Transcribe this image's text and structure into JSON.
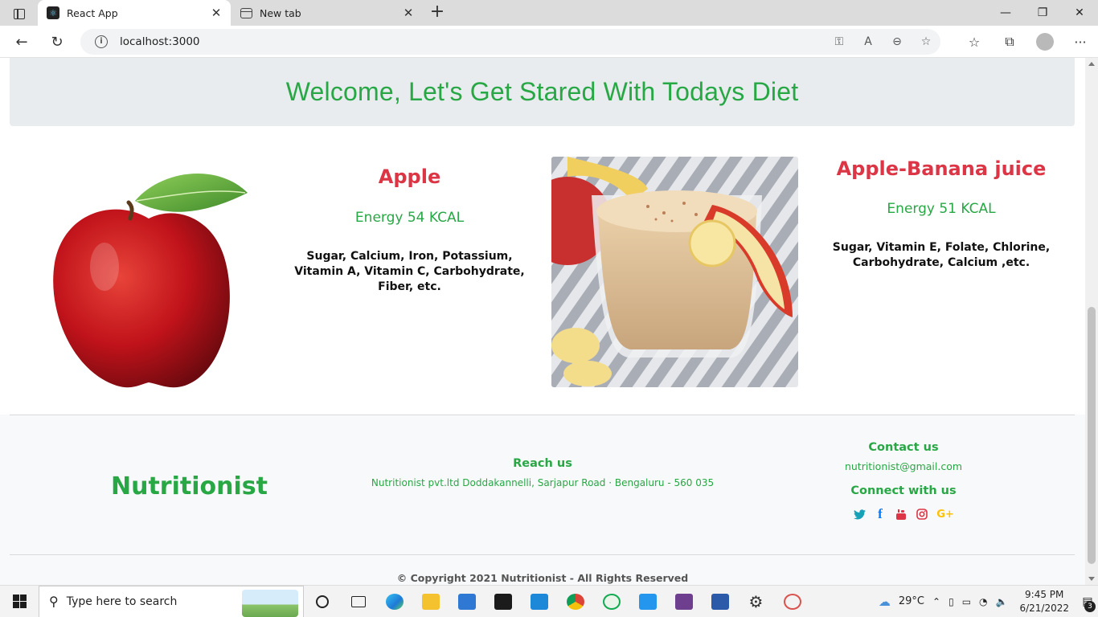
{
  "browser": {
    "tabs": [
      {
        "title": "React App",
        "active": true,
        "icon": "react-icon"
      },
      {
        "title": "New tab",
        "active": false,
        "icon": "new-tab-page-icon"
      }
    ],
    "new_tab_symbol": "+",
    "address_url": "localhost:3000",
    "window_controls": {
      "minimize": "—",
      "restore": "❐",
      "close": "✕"
    },
    "nav": {
      "back": "←",
      "refresh": "↻"
    },
    "address_icons": {
      "key": "⚿",
      "read_aloud": "A",
      "zoom": "⊖",
      "favorite": "☆"
    },
    "toolbar_icons": {
      "favorites": "☆",
      "collections": "⧉",
      "more": "···"
    }
  },
  "page": {
    "welcome_heading": "Welcome, Let's Get Stared With Todays Diet",
    "foods": [
      {
        "name": "Apple",
        "energy": "Energy 54 KCAL",
        "nutrients": "Sugar, Calcium, Iron, Potassium, Vitamin A, Vitamin C, Carbohydrate, Fiber, etc."
      },
      {
        "name": "Apple-Banana juice",
        "energy": "Energy 51 KCAL",
        "nutrients": "Sugar, Vitamin E, Folate, Chlorine, Carbohydrate, Calcium ,etc."
      }
    ],
    "footer": {
      "brand": "Nutritionist",
      "reach_title": "Reach us",
      "reach_address": "Nutritionist pvt.ltd Doddakannelli, Sarjapur Road · Bengaluru - 560 035",
      "contact_title": "Contact us",
      "contact_email": "nutritionist@gmail.com",
      "connect_title": "Connect with us",
      "social": [
        {
          "icon": "twitter-icon",
          "glyph": "🐦",
          "color": "#17a2b8"
        },
        {
          "icon": "facebook-icon",
          "glyph": "f",
          "color": "#007bff"
        },
        {
          "icon": "youtube-icon",
          "glyph": "▶",
          "color": "#dc3545"
        },
        {
          "icon": "instagram-icon",
          "glyph": "◎",
          "color": "#dc3545"
        },
        {
          "icon": "google-plus-icon",
          "glyph": "G+",
          "color": "#ffc107"
        }
      ],
      "copyright": "© Copyright 2021 Nutritionist - All Rights Reserved"
    },
    "colors": {
      "brand_green": "#28a745",
      "food_red": "#dc3545",
      "jumbotron": "#e9ecef"
    }
  },
  "taskbar": {
    "search_placeholder": "Type here to search",
    "apps": [
      "cortana-icon",
      "task-view-icon",
      "edge-icon",
      "file-explorer-icon",
      "mail-icon",
      "terminal-icon",
      "vscode-icon",
      "chrome-icon",
      "mongodb-icon",
      "docker-icon",
      "app-icon",
      "powershell-icon",
      "settings-icon",
      "snipping-tool-icon"
    ],
    "weather": "29°C",
    "time": "9:45 PM",
    "date": "6/21/2022",
    "notification_count": "3"
  }
}
